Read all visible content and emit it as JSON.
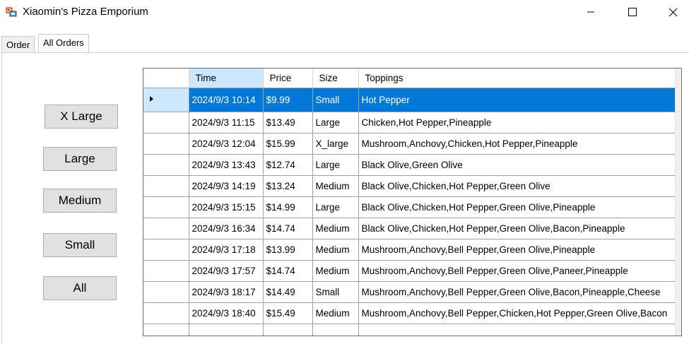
{
  "window": {
    "title": "Xiaomin's Pizza Emporium"
  },
  "tabs": [
    {
      "label": "Order"
    },
    {
      "label": "All Orders"
    }
  ],
  "filters": {
    "xlarge_label": "X Large",
    "large_label": "Large",
    "medium_label": "Medium",
    "small_label": "Small",
    "all_label": "All"
  },
  "grid": {
    "columns": [
      "Time",
      "Price",
      "Size",
      "Toppings"
    ],
    "rows": [
      {
        "time": "2024/9/3 10:14",
        "price": "$9.99",
        "size": "Small",
        "toppings": "Hot Pepper"
      },
      {
        "time": "2024/9/3 11:15",
        "price": "$13.49",
        "size": "Large",
        "toppings": "Chicken,Hot Pepper,Pineapple"
      },
      {
        "time": "2024/9/3 12:04",
        "price": "$15.99",
        "size": "X_large",
        "toppings": "Mushroom,Anchovy,Chicken,Hot Pepper,Pineapple"
      },
      {
        "time": "2024/9/3 13:43",
        "price": "$12.74",
        "size": "Large",
        "toppings": "Black Olive,Green Olive"
      },
      {
        "time": "2024/9/3 14:19",
        "price": "$13.24",
        "size": "Medium",
        "toppings": "Black Olive,Chicken,Hot Pepper,Green Olive"
      },
      {
        "time": "2024/9/3 15:15",
        "price": "$14.99",
        "size": "Large",
        "toppings": "Black Olive,Chicken,Hot Pepper,Green Olive,Pineapple"
      },
      {
        "time": "2024/9/3 16:34",
        "price": "$14.74",
        "size": "Medium",
        "toppings": "Black Olive,Chicken,Hot Pepper,Green Olive,Bacon,Pineapple"
      },
      {
        "time": "2024/9/3 17:18",
        "price": "$13.99",
        "size": "Medium",
        "toppings": "Mushroom,Anchovy,Bell Pepper,Green Olive,Pineapple"
      },
      {
        "time": "2024/9/3 17:57",
        "price": "$14.74",
        "size": "Medium",
        "toppings": "Mushroom,Anchovy,Bell Pepper,Green Olive,Paneer,Pineapple"
      },
      {
        "time": "2024/9/3 18:17",
        "price": "$14.49",
        "size": "Small",
        "toppings": "Mushroom,Anchovy,Bell Pepper,Green Olive,Bacon,Pineapple,Cheese"
      },
      {
        "time": "2024/9/3 18:40",
        "price": "$15.49",
        "size": "Medium",
        "toppings": "Mushroom,Anchovy,Bell Pepper,Chicken,Hot Pepper,Green Olive,Bacon"
      }
    ],
    "new_row_marker": "*"
  }
}
